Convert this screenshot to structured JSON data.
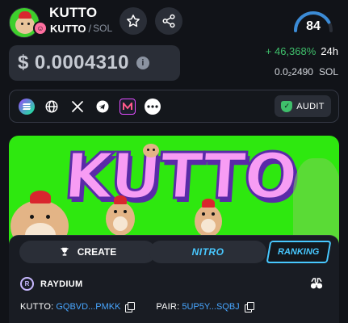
{
  "token": {
    "name": "KUTTO",
    "symbol": "KUTTO",
    "separator": "/",
    "chain": "SOL",
    "avatar_icon": "hamster-avatar",
    "chain_badge_icon": "pump-badge-icon"
  },
  "header_actions": {
    "favorite_icon": "star-icon",
    "share_icon": "share-icon"
  },
  "score": {
    "value": "84",
    "fraction": 0.84,
    "color": "#3b8bd6"
  },
  "price": {
    "value": "$ 0.0004310",
    "info_glyph": "i"
  },
  "change": {
    "percent": "+ 46,368%",
    "period": "24h",
    "color": "#3fbf6b"
  },
  "liquidity": {
    "value": "0.0₂2490",
    "unit": "SOL"
  },
  "links": {
    "items": [
      {
        "name": "solana-icon"
      },
      {
        "name": "website-globe-icon"
      },
      {
        "name": "x-twitter-icon"
      },
      {
        "name": "telegram-icon"
      },
      {
        "name": "pump-fun-icon"
      },
      {
        "name": "more-icon"
      }
    ],
    "audit_label": "AUDIT"
  },
  "banner": {
    "title": "KUTTO",
    "background": "#2ee80f",
    "text_color": "#f79cf4"
  },
  "tabs": {
    "create": "CREATE",
    "nitro": "NITRO",
    "ranking": "RANKING"
  },
  "dex": {
    "name": "RAYDIUM",
    "badge_glyph": "R"
  },
  "addresses": {
    "token_label": "KUTTO:",
    "token_value": "GQBVD...PMKK",
    "pair_label": "PAIR:",
    "pair_value": "5UP5Y...SQBJ"
  },
  "colors": {
    "background": "#111318",
    "surface": "#2a2e37",
    "accent_blue": "#48c8ff",
    "link_blue": "#48a6ff"
  }
}
